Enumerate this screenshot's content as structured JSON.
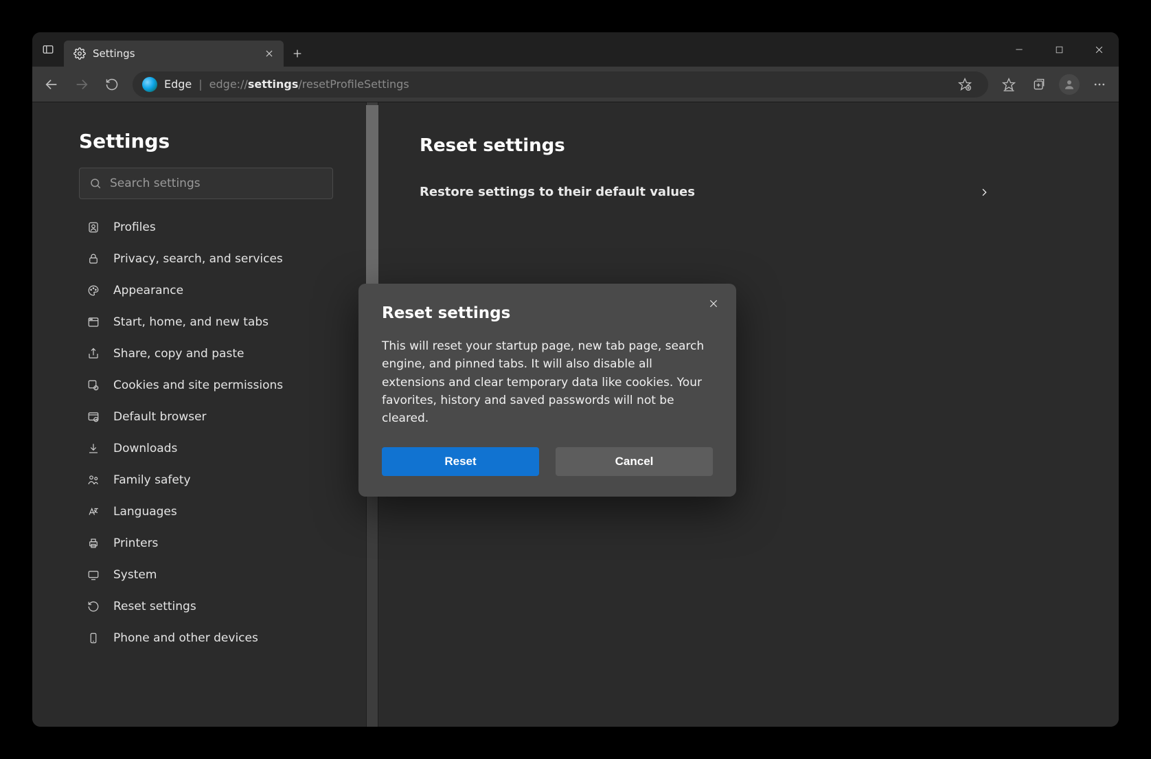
{
  "tab": {
    "title": "Settings"
  },
  "toolbar": {
    "edge_label": "Edge",
    "url_prefix": "edge://",
    "url_strong": "settings",
    "url_rest": "/resetProfileSettings"
  },
  "sidebar": {
    "title": "Settings",
    "search_placeholder": "Search settings",
    "items": [
      {
        "label": "Profiles"
      },
      {
        "label": "Privacy, search, and services"
      },
      {
        "label": "Appearance"
      },
      {
        "label": "Start, home, and new tabs"
      },
      {
        "label": "Share, copy and paste"
      },
      {
        "label": "Cookies and site permissions"
      },
      {
        "label": "Default browser"
      },
      {
        "label": "Downloads"
      },
      {
        "label": "Family safety"
      },
      {
        "label": "Languages"
      },
      {
        "label": "Printers"
      },
      {
        "label": "System"
      },
      {
        "label": "Reset settings"
      },
      {
        "label": "Phone and other devices"
      }
    ]
  },
  "main": {
    "section_title": "Reset settings",
    "row_label": "Restore settings to their default values"
  },
  "dialog": {
    "title": "Reset settings",
    "body": "This will reset your startup page, new tab page, search engine, and pinned tabs. It will also disable all extensions and clear temporary data like cookies. Your favorites, history and saved passwords will not be cleared.",
    "primary": "Reset",
    "secondary": "Cancel"
  }
}
